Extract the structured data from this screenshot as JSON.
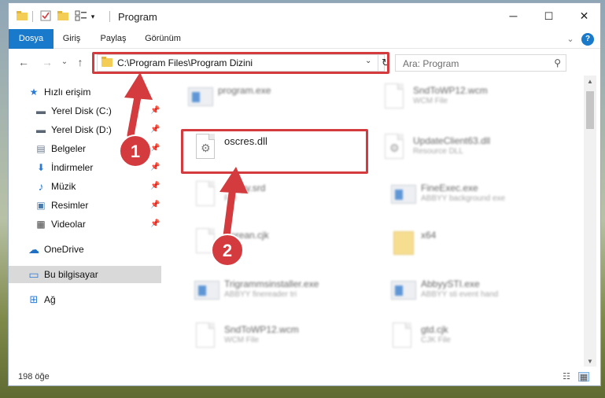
{
  "window": {
    "title": "Program",
    "controls": {
      "minimize": "─",
      "maximize": "☐",
      "close": "✕"
    }
  },
  "ribbon": {
    "tabs": [
      "Dosya",
      "Giriş",
      "Paylaş",
      "Görünüm"
    ],
    "expand": "⌄",
    "help": "?"
  },
  "nav": {
    "back": "←",
    "forward": "→",
    "recent": "⌄",
    "up": "↑",
    "address": "C:\\Program Files\\Program Dizini",
    "address_dropdown": "⌄",
    "refresh": "↻",
    "search_placeholder": "Ara: Program",
    "search_icon": "⚲"
  },
  "sidebar": {
    "items": [
      {
        "label": "Hızlı erişim",
        "icon": "★",
        "icon_color": "#2a7bd5",
        "pinned": false
      },
      {
        "label": "Yerel Disk (C:)",
        "icon": "▬",
        "icon_color": "#5a6676",
        "pinned": true
      },
      {
        "label": "Yerel Disk (D:)",
        "icon": "▬",
        "icon_color": "#5a6676",
        "pinned": true
      },
      {
        "label": "Belgeler",
        "icon": "▤",
        "icon_color": "#6b7a8c",
        "pinned": true
      },
      {
        "label": "İndirmeler",
        "icon": "⬇",
        "icon_color": "#2a7bd5",
        "pinned": true
      },
      {
        "label": "Müzik",
        "icon": "♪",
        "icon_color": "#2a7bd5",
        "pinned": true
      },
      {
        "label": "Resimler",
        "icon": "▣",
        "icon_color": "#4a7cae",
        "pinned": true
      },
      {
        "label": "Videolar",
        "icon": "▦",
        "icon_color": "#444444",
        "pinned": true
      },
      {
        "label": "OneDrive",
        "icon": "☁",
        "icon_color": "#1f6fc4",
        "pinned": false
      },
      {
        "label": "Bu bilgisayar",
        "icon": "▭",
        "icon_color": "#2a7bd5",
        "pinned": false,
        "selected": true
      },
      {
        "label": "Ağ",
        "icon": "⊞",
        "icon_color": "#2a7bd5",
        "pinned": false
      }
    ],
    "pin_glyph": "📌"
  },
  "files": [
    {
      "name": "program.exe",
      "sub": "",
      "kind": "exe-app"
    },
    {
      "name": "SndToWP12.wcm",
      "sub": "WCM File",
      "kind": "doc"
    },
    {
      "name": "oscres.dll",
      "sub": "",
      "kind": "dll"
    },
    {
      "name": "UpdateClient63.dll",
      "sub": "Resource DLL",
      "kind": "dll"
    },
    {
      "name": "Abbyy.srd",
      "sub": "File",
      "kind": "doc"
    },
    {
      "name": "FineExec.exe",
      "sub": "ABBYY background exe",
      "kind": "exe"
    },
    {
      "name": "Korean.cjk",
      "sub": "",
      "kind": "doc"
    },
    {
      "name": "x64",
      "sub": "",
      "kind": "folder"
    },
    {
      "name": "Trigrammsinstaller.exe",
      "sub": "ABBYY finereader tri",
      "kind": "exe"
    },
    {
      "name": "AbbyySTI.exe",
      "sub": "ABBYY sti event hand",
      "kind": "exe"
    },
    {
      "name": "SndToWP12.wcm",
      "sub": "WCM File",
      "kind": "doc"
    },
    {
      "name": "gtd.cjk",
      "sub": "CJK File",
      "kind": "doc"
    }
  ],
  "status": {
    "count": "198 öğe",
    "details_icon": "☷",
    "tiles_icon": "▦"
  },
  "annotations": {
    "step1": "1",
    "step2": "2",
    "accent": "#d33b3f"
  }
}
